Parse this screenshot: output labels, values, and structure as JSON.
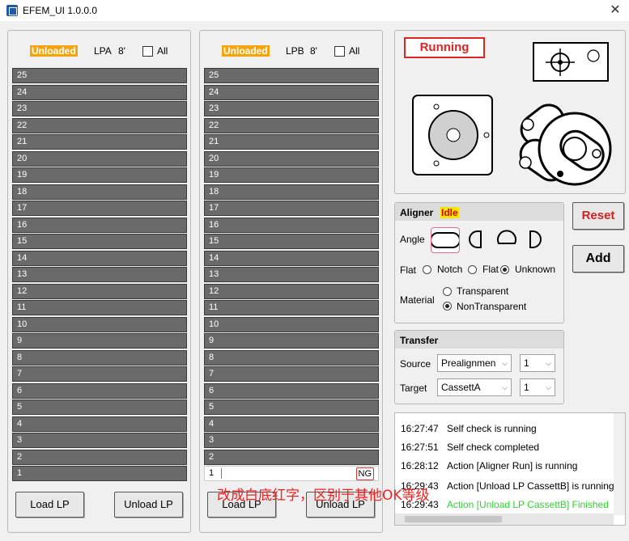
{
  "window": {
    "title": "EFEM_UI 1.0.0.0",
    "close_label": "✕"
  },
  "lpa": {
    "status": "Unloaded",
    "name": "LPA",
    "size": "8'",
    "all_label": "All",
    "slots": [
      "25",
      "24",
      "23",
      "22",
      "21",
      "20",
      "19",
      "18",
      "17",
      "16",
      "15",
      "14",
      "13",
      "12",
      "11",
      "10",
      "9",
      "8",
      "7",
      "6",
      "5",
      "4",
      "3",
      "2",
      "1"
    ],
    "load_label": "Load LP",
    "unload_label": "Unload LP"
  },
  "lpb": {
    "status": "Unloaded",
    "name": "LPB",
    "size": "8'",
    "all_label": "All",
    "slots": [
      "25",
      "24",
      "23",
      "22",
      "21",
      "20",
      "19",
      "18",
      "17",
      "16",
      "15",
      "14",
      "13",
      "12",
      "11",
      "10",
      "9",
      "8",
      "7",
      "6",
      "5",
      "4",
      "3",
      "2",
      "1"
    ],
    "slot1_tag": "NG",
    "load_label": "Load LP",
    "unload_label": "Unload LP"
  },
  "status": {
    "running_label": "Running"
  },
  "aligner": {
    "title": "Aligner",
    "state": "Idle",
    "angle_label": "Angle",
    "flat_label": "Flat",
    "flat_options": [
      "Notch",
      "Flat",
      "Unknown"
    ],
    "flat_selected": "Unknown",
    "material_label": "Material",
    "material_options": [
      "Transparent",
      "NonTransparent"
    ],
    "material_selected": "NonTransparent"
  },
  "actions": {
    "reset_label": "Reset",
    "add_label": "Add"
  },
  "transfer": {
    "title": "Transfer",
    "source_label": "Source",
    "source_value": "Prealignmen",
    "source_slot": "1",
    "target_label": "Target",
    "target_value": "CassettA",
    "target_slot": "1"
  },
  "log": [
    {
      "time": "16:27:47",
      "message": "Self check is running"
    },
    {
      "time": "16:27:51",
      "message": "Self check completed"
    },
    {
      "time": "16:28:12",
      "message": "Action [Aligner Run] is running"
    },
    {
      "time": "16:29:43",
      "message": "Action [Unload LP CassettB] is running"
    },
    {
      "time": "16:29:43",
      "message": "Action [Unload LP CassettB] Finished"
    }
  ],
  "annotation": "改成白底红字，区别于其他OK等级",
  "colors": {
    "unloaded": "#f5a50b",
    "running": "#e02424",
    "idle_bg": "#f7e600",
    "finished": "#2fd22f",
    "annotation": "#ee2222"
  }
}
